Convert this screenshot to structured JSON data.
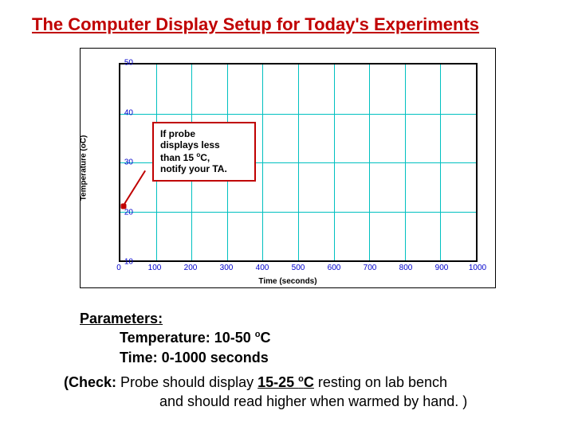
{
  "title": "The Computer Display Setup for Today's Experiments",
  "chart_data": {
    "type": "scatter",
    "title": "",
    "xlabel": "Time (seconds)",
    "ylabel": "Temperature (oC)",
    "xlim": [
      0,
      1000
    ],
    "ylim": [
      10,
      50
    ],
    "xticks": [
      0,
      100,
      200,
      300,
      400,
      500,
      600,
      700,
      800,
      900,
      1000
    ],
    "yticks": [
      10,
      20,
      30,
      40,
      50
    ],
    "series": [
      {
        "name": "probe",
        "x": [
          10
        ],
        "y": [
          21
        ]
      }
    ],
    "annotation": {
      "text": "If probe displays less than 15 oC, notify your TA.",
      "points_to": {
        "x": 10,
        "y": 21
      }
    }
  },
  "callout": {
    "line1": "If probe",
    "line2": "displays less",
    "line3a": "than 15 ",
    "line3deg": "o",
    "line3b": "C,",
    "line4": "notify your TA."
  },
  "params": {
    "heading": "Parameters:",
    "temp_label": "Temperature:  10-50 ",
    "temp_deg": "o",
    "temp_unit": "C",
    "time_label": "Time: 0-1000 seconds"
  },
  "check": {
    "open": "(Check:",
    "mid1": "  Probe should display ",
    "range": "15-25 ",
    "range_deg": "o",
    "range_unit": "C",
    "mid2": " resting on lab bench",
    "line2": "and should read higher when warmed by hand. )"
  }
}
